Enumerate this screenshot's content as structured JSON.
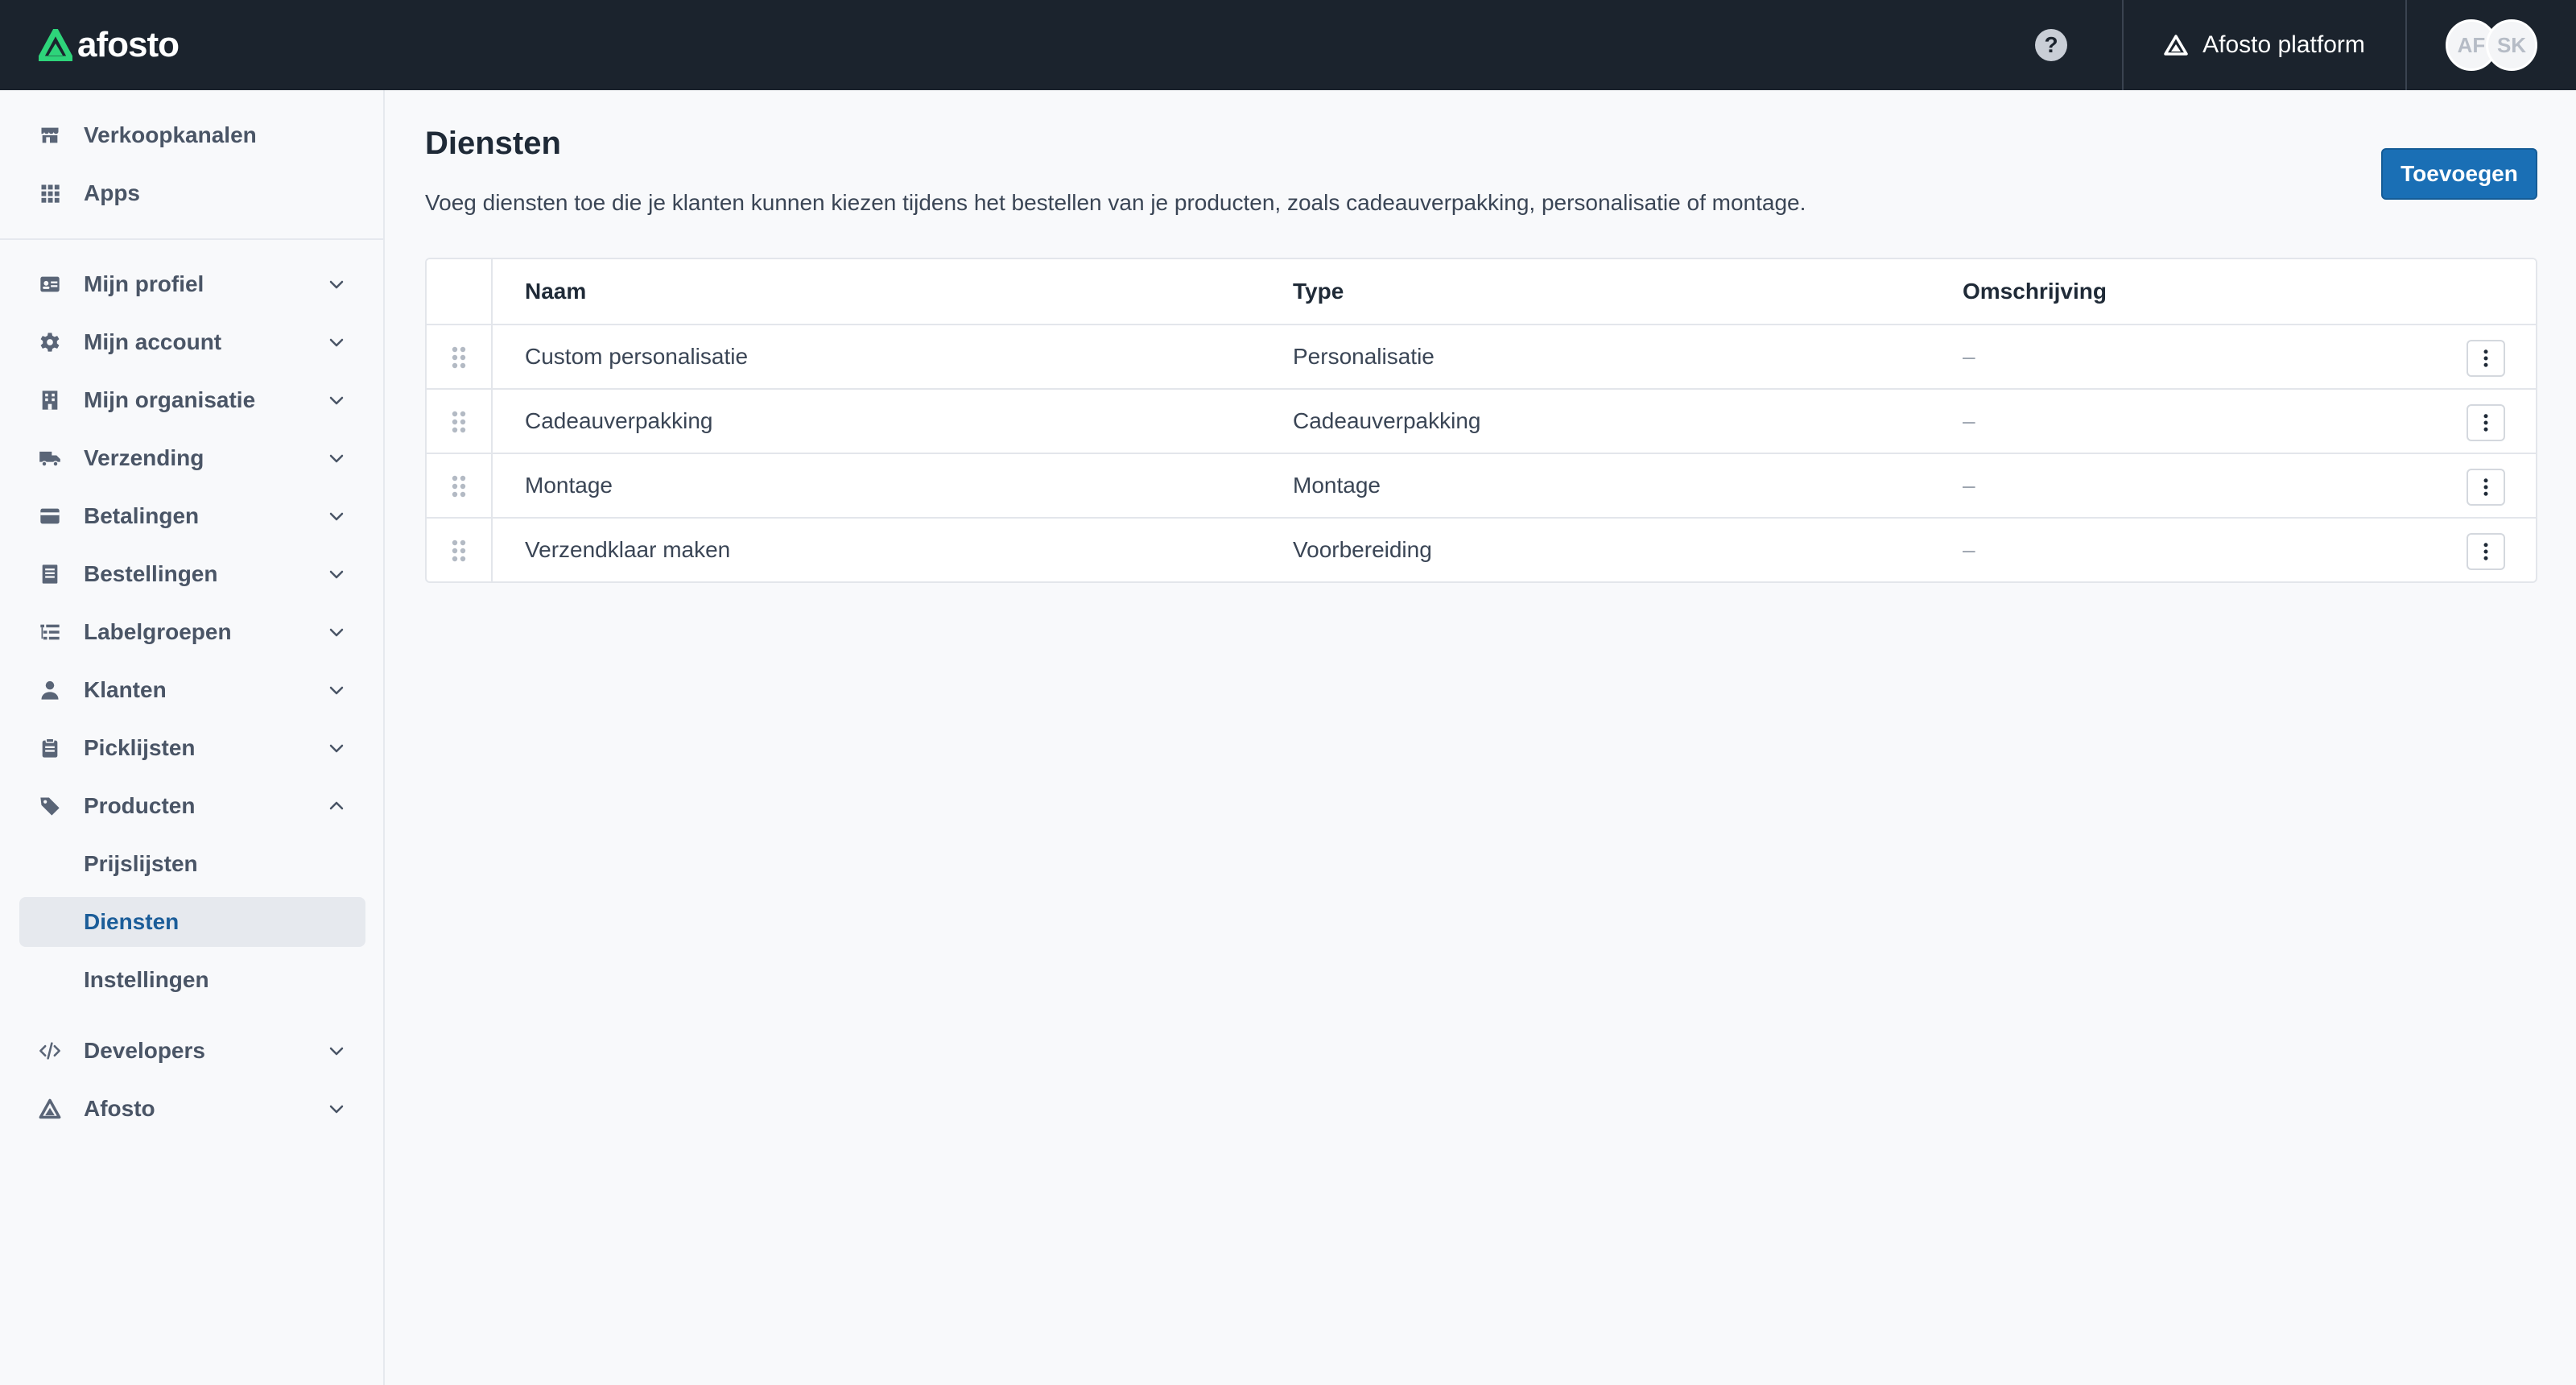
{
  "topbar": {
    "logo_text": "afosto",
    "brand_color": "#2ed47a",
    "help_label": "?",
    "platform_label": "Afosto platform",
    "avatars": [
      "AF",
      "SK"
    ]
  },
  "sidebar": {
    "top_items": [
      {
        "label": "Verkoopkanalen",
        "icon": "store-icon"
      },
      {
        "label": "Apps",
        "icon": "grid-icon"
      }
    ],
    "items": [
      {
        "label": "Mijn profiel",
        "icon": "id-card-icon",
        "expanded": false
      },
      {
        "label": "Mijn account",
        "icon": "gear-icon",
        "expanded": false
      },
      {
        "label": "Mijn organisatie",
        "icon": "building-icon",
        "expanded": false
      },
      {
        "label": "Verzending",
        "icon": "truck-icon",
        "expanded": false
      },
      {
        "label": "Betalingen",
        "icon": "credit-card-icon",
        "expanded": false
      },
      {
        "label": "Bestellingen",
        "icon": "receipt-icon",
        "expanded": false
      },
      {
        "label": "Labelgroepen",
        "icon": "list-icon",
        "expanded": false
      },
      {
        "label": "Klanten",
        "icon": "user-icon",
        "expanded": false
      },
      {
        "label": "Picklijsten",
        "icon": "clipboard-icon",
        "expanded": false
      },
      {
        "label": "Producten",
        "icon": "tag-icon",
        "expanded": true
      }
    ],
    "sub_items": [
      {
        "label": "Prijslijsten",
        "active": false
      },
      {
        "label": "Diensten",
        "active": true
      },
      {
        "label": "Instellingen",
        "active": false
      }
    ],
    "bottom_items": [
      {
        "label": "Developers",
        "icon": "code-icon",
        "expanded": false
      },
      {
        "label": "Afosto",
        "icon": "afosto-logo-icon",
        "expanded": false
      }
    ]
  },
  "main": {
    "title": "Diensten",
    "description": "Voeg diensten toe die je klanten kunnen kiezen tijdens het bestellen van je producten, zoals cadeauverpakking, personalisatie of montage.",
    "add_button": "Toevoegen",
    "table": {
      "columns": [
        "Naam",
        "Type",
        "Omschrijving"
      ],
      "rows": [
        {
          "name": "Custom personalisatie",
          "type": "Personalisatie",
          "description": "–"
        },
        {
          "name": "Cadeauverpakking",
          "type": "Cadeauverpakking",
          "description": "–"
        },
        {
          "name": "Montage",
          "type": "Montage",
          "description": "–"
        },
        {
          "name": "Verzendklaar maken",
          "type": "Voorbereiding",
          "description": "–"
        }
      ]
    }
  },
  "colors": {
    "topbar_bg": "#1b232d",
    "primary": "#1a6fb5",
    "active_text": "#1b5d99"
  }
}
